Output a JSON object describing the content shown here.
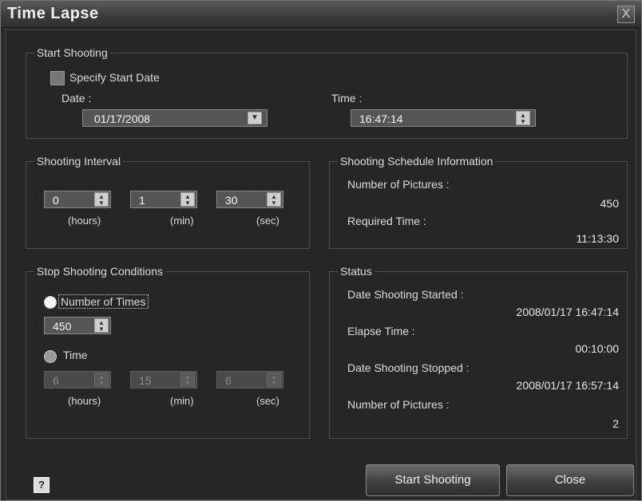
{
  "window": {
    "title": "Time Lapse",
    "close_glyph": "X"
  },
  "start_shooting": {
    "legend": "Start Shooting",
    "specify_start_date_label": "Specify Start Date",
    "date_label": "Date :",
    "date_value": "01/17/2008",
    "time_label": "Time :",
    "time_value": "16:47:14"
  },
  "shooting_interval": {
    "legend": "Shooting Interval",
    "hours_value": "0",
    "min_value": "1",
    "sec_value": "30",
    "hours_unit": "(hours)",
    "min_unit": "(min)",
    "sec_unit": "(sec)"
  },
  "schedule_info": {
    "legend": "Shooting Schedule Information",
    "num_pictures_label": "Number of Pictures :",
    "num_pictures_value": "450",
    "required_time_label": "Required Time :",
    "required_time_value": "11:13:30"
  },
  "stop_conditions": {
    "legend": "Stop Shooting Conditions",
    "number_of_times_label": "Number of Times",
    "number_of_times_value": "450",
    "time_label": "Time",
    "hours_value": "6",
    "min_value": "15",
    "sec_value": "6",
    "hours_unit": "(hours)",
    "min_unit": "(min)",
    "sec_unit": "(sec)",
    "selected": "number_of_times"
  },
  "status": {
    "legend": "Status",
    "date_started_label": "Date Shooting Started :",
    "date_started_value": "2008/01/17 16:47:14",
    "elapse_time_label": "Elapse Time :",
    "elapse_time_value": "00:10:00",
    "date_stopped_label": "Date Shooting Stopped :",
    "date_stopped_value": "2008/01/17 16:57:14",
    "num_pictures_label": "Number of Pictures :",
    "num_pictures_value": "2"
  },
  "footer": {
    "help_glyph": "?",
    "start_button": "Start Shooting",
    "close_button": "Close"
  },
  "icons": {
    "close": "close-icon",
    "dropdown": "chevron-down-icon",
    "spinner": "spinner-icon",
    "help": "help-icon"
  }
}
